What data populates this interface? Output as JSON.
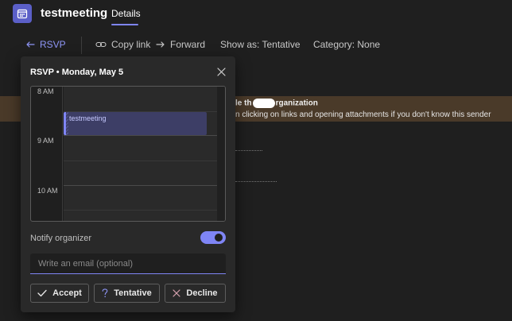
{
  "header": {
    "app_icon": "calendar-icon",
    "title": "testmeeting",
    "tabs": [
      {
        "label": "Details",
        "active": true
      }
    ]
  },
  "toolbar": {
    "rsvp": {
      "label": "RSVP",
      "icon": "reply-arrow-icon"
    },
    "copy_link": {
      "label": "Copy link",
      "icon": "link-icon"
    },
    "forward": {
      "label": "Forward",
      "icon": "arrow-right-icon"
    },
    "show_as": "Show as: Tentative",
    "category": "Category: None"
  },
  "background": {
    "warning_title_prefix": "le th",
    "warning_title_suffix": "rganization",
    "warning_text": "n clicking on links and opening attachments if you don't know this sender"
  },
  "popup": {
    "title": "RSVP • Monday, May 5",
    "calendar": {
      "hours": [
        "8 AM",
        "9 AM",
        "10 AM"
      ],
      "event": {
        "title": "testmeeting"
      }
    },
    "notify_organizer": {
      "label": "Notify organizer",
      "enabled": true
    },
    "email": {
      "placeholder": "Write an email (optional)",
      "value": ""
    },
    "buttons": [
      {
        "label": "Accept",
        "icon": "checkmark-icon"
      },
      {
        "label": "Tentative",
        "icon": "question-mark-icon"
      },
      {
        "label": "Decline",
        "icon": "close-icon"
      }
    ]
  },
  "colors": {
    "accent": "#7f85f5",
    "background": "#1f1f1f",
    "popup": "#292929",
    "warning_banner": "#4a3a29",
    "event_fill": "#3d3e66"
  }
}
